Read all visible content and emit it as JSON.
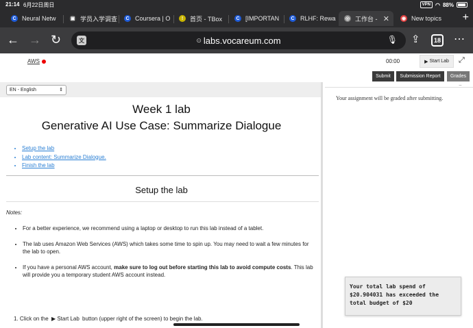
{
  "status": {
    "time": "21:14",
    "date": "6月22日周日",
    "vpn": "VPN",
    "battery": "88%"
  },
  "tabs": [
    {
      "label": "Neural Netw",
      "favicon": "C",
      "color": "#1e5bd8"
    },
    {
      "label": "学员入学调查",
      "favicon": "▣",
      "color": "#444"
    },
    {
      "label": "Coursera | O",
      "favicon": "C",
      "color": "#1e5bd8"
    },
    {
      "label": "首页 - TBox",
      "favicon": "!",
      "color": "#c8b400"
    },
    {
      "label": "[IMPORTAN",
      "favicon": "C",
      "color": "#1e5bd8"
    },
    {
      "label": "RLHF: Rewa",
      "favicon": "C",
      "color": "#1e5bd8"
    },
    {
      "label": "工作台 -",
      "favicon": "◎",
      "color": "#888"
    },
    {
      "label": "New topics",
      "favicon": "◉",
      "color": "#e04040"
    }
  ],
  "omnibox": {
    "url": "labs.vocareum.com",
    "tab_count": "18"
  },
  "lab": {
    "aws_label": "AWS",
    "timer": "00:00",
    "start_lab": "Start Lab",
    "buttons": {
      "submit": "Submit",
      "report": "Submission Report",
      "grades": "Grades"
    }
  },
  "language": "EN - English",
  "content": {
    "title1": "Week 1 lab",
    "title2": "Generative AI Use Case: Summarize Dialogue",
    "toc": [
      "Setup the lab",
      "Lab content: Summarize Dialogue.",
      "Finish the lab"
    ],
    "section_title": "Setup the lab",
    "notes_label": "Notes:",
    "bullet1": "For a better experience, we recommend using a laptop or desktop to run this lab instead of a tablet.",
    "bullet2": "The lab uses Amazon Web Services (AWS) which takes some time to spin up. You may need to wait a few minutes for the lab to open.",
    "bullet3_pre": "If you have a personal AWS account, ",
    "bullet3_bold": "make sure to log out before starting this lab to avoid compute costs",
    "bullet3_post": ". This lab will provide you a temporary student AWS account instead.",
    "step1_pre": "1.  Click on the",
    "step1_kbd": "Start Lab",
    "step1_post": "button (upper right of the screen) to begin the lab."
  },
  "right": {
    "graded_text": "Your assignment will be graded after submitting.",
    "spend_line1": "Your total lab spend of",
    "spend_line2": "$20.904031 has exceeded the",
    "spend_line3": "total budget of $20"
  }
}
